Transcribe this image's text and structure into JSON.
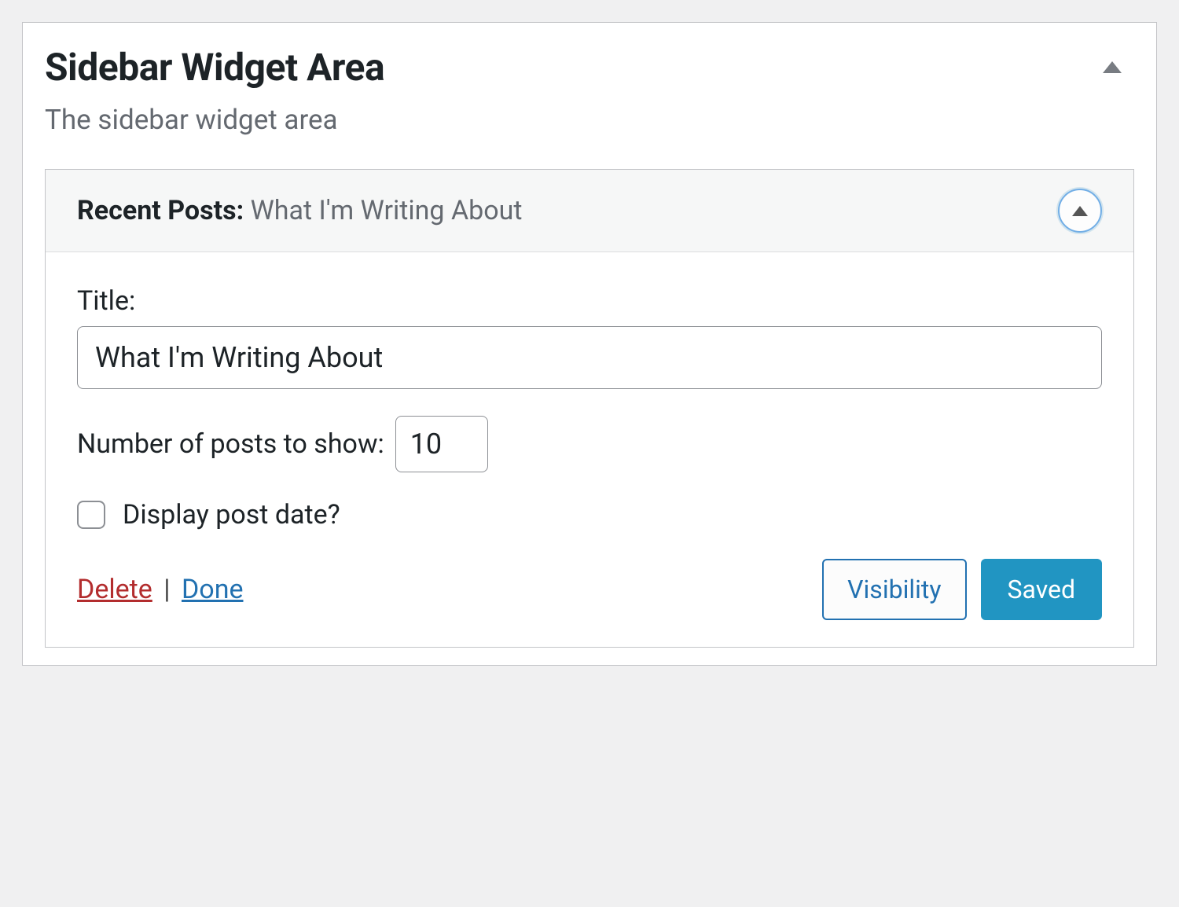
{
  "panel": {
    "title": "Sidebar Widget Area",
    "description": "The sidebar widget area"
  },
  "widget": {
    "type_label": "Recent Posts",
    "name": "What I'm Writing About",
    "separator": ": ",
    "fields": {
      "title_label": "Title:",
      "title_value": "What I'm Writing About",
      "count_label": "Number of posts to show:",
      "count_value": "10",
      "date_label": "Display post date?"
    },
    "actions": {
      "delete": "Delete",
      "separator": "|",
      "done": "Done",
      "visibility": "Visibility",
      "saved": "Saved"
    }
  }
}
